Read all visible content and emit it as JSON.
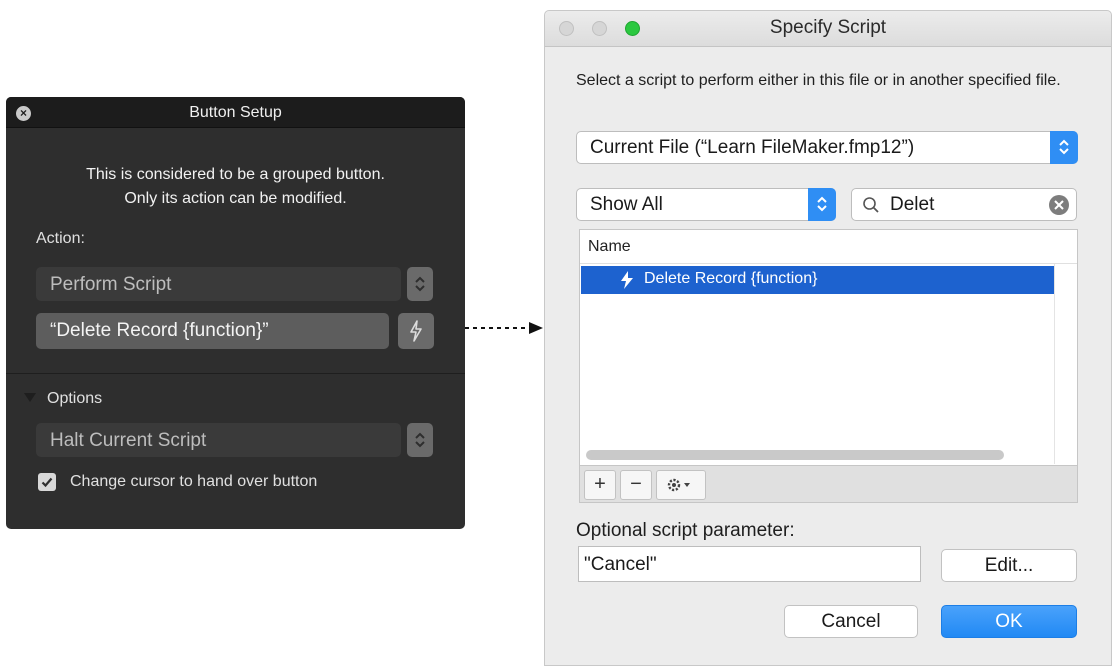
{
  "button_setup": {
    "title": "Button Setup",
    "message_line1": "This is considered to be a grouped button.",
    "message_line2": "Only its action can be modified.",
    "action_label": "Action:",
    "action_value": "Perform Script",
    "script_value": "“Delete Record {function}”",
    "options_label": "Options",
    "option_value": "Halt Current Script",
    "checkbox_label": "Change cursor to hand over button",
    "checkbox_checked": true
  },
  "specify_script": {
    "title": "Specify Script",
    "description": "Select a script to perform either in this file or in another specified file.",
    "file_select": "Current File (“Learn FileMaker.fmp12”)",
    "filter_select": "Show All",
    "search_value": "Delet",
    "list_header": "Name",
    "scripts": [
      {
        "name": "Delete Record {function}",
        "selected": true
      }
    ],
    "toolbar": {
      "add": "+",
      "remove": "−"
    },
    "param_label": "Optional script parameter:",
    "param_value": "\"Cancel\"",
    "edit_button": "Edit...",
    "cancel_button": "Cancel",
    "ok_button": "OK"
  },
  "colors": {
    "panel_bg": "#2e2e2e",
    "selection": "#1d62cf",
    "accent_blue": "#2f8ef4",
    "green_light": "#2bc840"
  }
}
